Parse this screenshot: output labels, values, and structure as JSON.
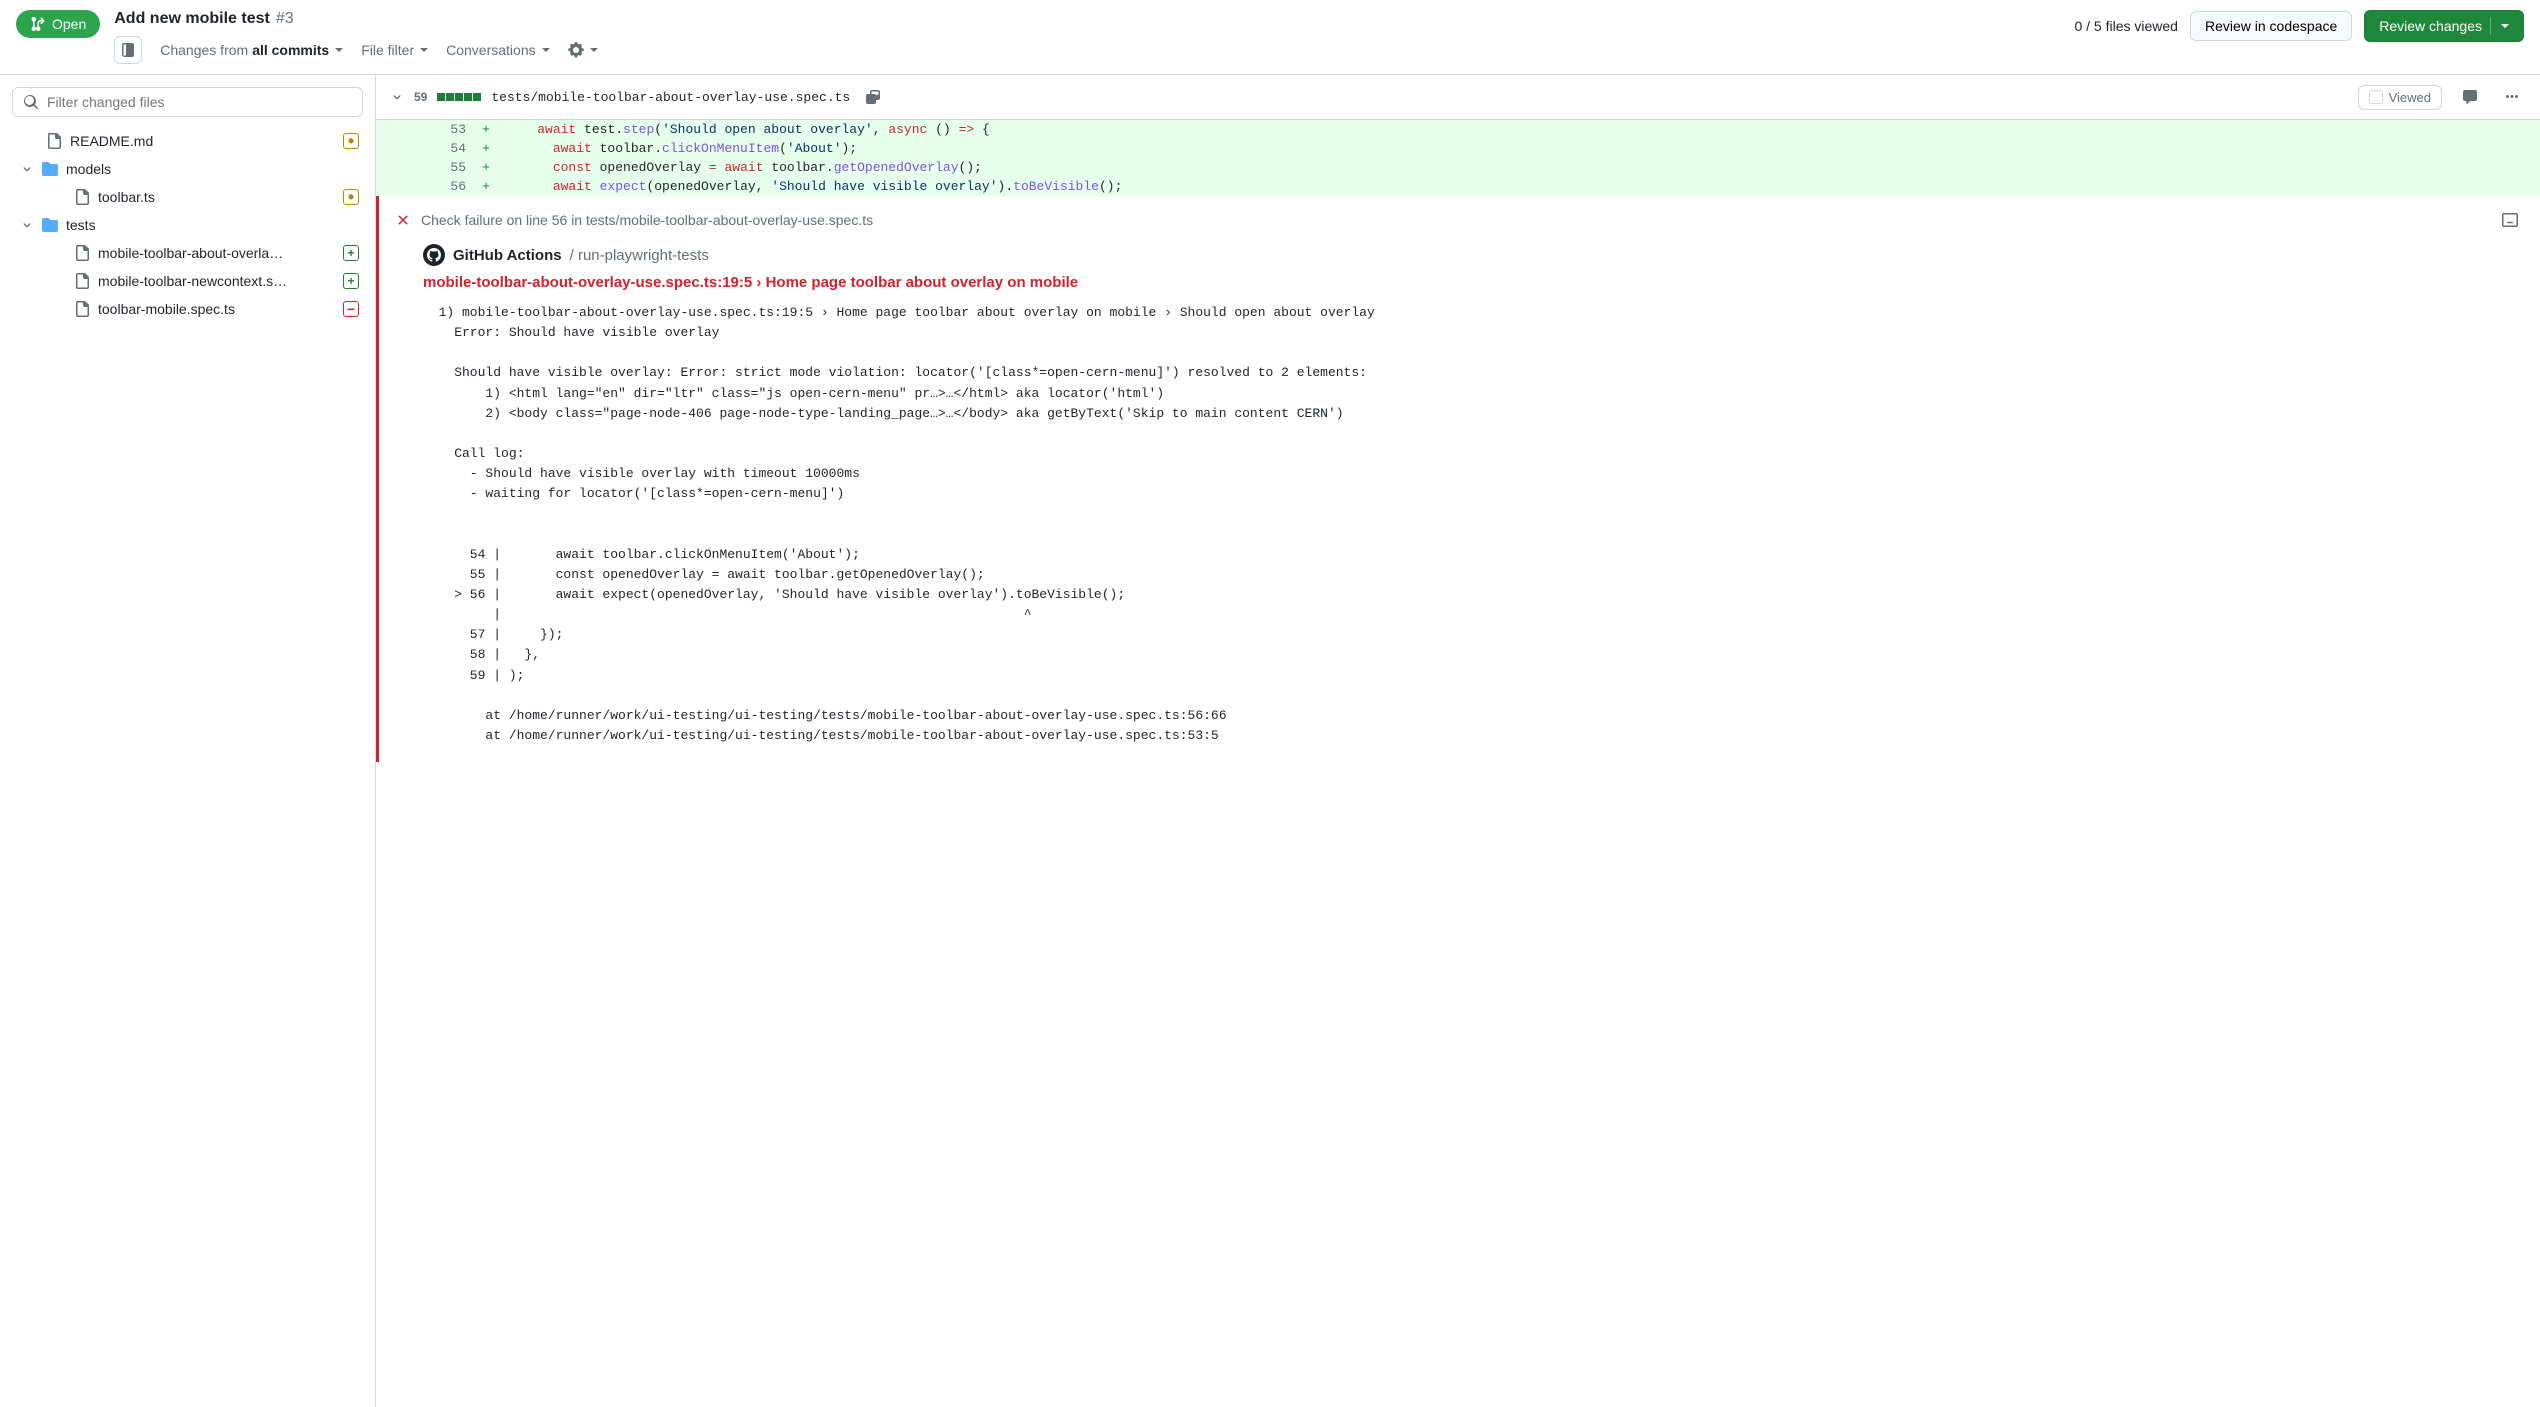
{
  "header": {
    "state": "Open",
    "title": "Add new mobile test",
    "pr_number": "#3",
    "changes_from_label": "Changes from",
    "changes_from_value": "all commits",
    "file_filter": "File filter",
    "conversations": "Conversations",
    "files_viewed": "0 / 5 files viewed",
    "review_codespace": "Review in codespace",
    "review_changes": "Review changes"
  },
  "sidebar": {
    "filter_placeholder": "Filter changed files",
    "items": [
      {
        "type": "file",
        "name": "README.md",
        "status": "modified",
        "indent": 0
      },
      {
        "type": "folder",
        "name": "models",
        "expanded": true,
        "indent": 0
      },
      {
        "type": "file",
        "name": "toolbar.ts",
        "status": "modified",
        "indent": 1
      },
      {
        "type": "folder",
        "name": "tests",
        "expanded": true,
        "indent": 0
      },
      {
        "type": "file",
        "name": "mobile-toolbar-about-overla…",
        "status": "added",
        "indent": 1
      },
      {
        "type": "file",
        "name": "mobile-toolbar-newcontext.s…",
        "status": "added",
        "indent": 1
      },
      {
        "type": "file",
        "name": "toolbar-mobile.spec.ts",
        "status": "removed",
        "indent": 1
      }
    ]
  },
  "file": {
    "additions": "59",
    "path": "tests/mobile-toolbar-about-overlay-use.spec.ts",
    "viewed_label": "Viewed",
    "lines": [
      {
        "num": "53",
        "marker": "+",
        "tokens": [
          [
            "",
            "    "
          ],
          [
            "kw",
            "await"
          ],
          [
            "",
            " test."
          ],
          [
            "fn",
            "step"
          ],
          [
            "",
            "("
          ],
          [
            "str",
            "'Should open about overlay'"
          ],
          [
            "",
            ", "
          ],
          [
            "kw",
            "async"
          ],
          [
            "",
            " () "
          ],
          [
            "op",
            "=>"
          ],
          [
            "",
            " {"
          ]
        ]
      },
      {
        "num": "54",
        "marker": "+",
        "tokens": [
          [
            "",
            "      "
          ],
          [
            "kw",
            "await"
          ],
          [
            "",
            " toolbar."
          ],
          [
            "fn",
            "clickOnMenuItem"
          ],
          [
            "",
            "("
          ],
          [
            "str",
            "'About'"
          ],
          [
            "",
            ");"
          ]
        ]
      },
      {
        "num": "55",
        "marker": "+",
        "tokens": [
          [
            "",
            "      "
          ],
          [
            "kw",
            "const"
          ],
          [
            "",
            " openedOverlay "
          ],
          [
            "op",
            "="
          ],
          [
            "",
            " "
          ],
          [
            "kw",
            "await"
          ],
          [
            "",
            " toolbar."
          ],
          [
            "fn",
            "getOpenedOverlay"
          ],
          [
            "",
            "();"
          ]
        ]
      },
      {
        "num": "56",
        "marker": "+",
        "tokens": [
          [
            "",
            "      "
          ],
          [
            "kw",
            "await"
          ],
          [
            "",
            " "
          ],
          [
            "fn",
            "expect"
          ],
          [
            "",
            "(openedOverlay, "
          ],
          [
            "str",
            "'Should have visible overlay'"
          ],
          [
            "",
            ")."
          ],
          [
            "fn",
            "toBeVisible"
          ],
          [
            "",
            "();"
          ]
        ]
      }
    ]
  },
  "annotation": {
    "check_line": "Check failure on line 56 in tests/mobile-toolbar-about-overlay-use.spec.ts",
    "app_name": "GitHub Actions",
    "app_context": "/ run-playwright-tests",
    "fail_title": "mobile-toolbar-about-overlay-use.spec.ts:19:5 › Home page toolbar about overlay on mobile",
    "log": "  1) mobile-toolbar-about-overlay-use.spec.ts:19:5 › Home page toolbar about overlay on mobile › Should open about overlay\n    Error: Should have visible overlay\n\n    Should have visible overlay: Error: strict mode violation: locator('[class*=open-cern-menu]') resolved to 2 elements:\n        1) <html lang=\"en\" dir=\"ltr\" class=\"js open-cern-menu\" pr…>…</html> aka locator('html')\n        2) <body class=\"page-node-406 page-node-type-landing_page…>…</body> aka getByText('Skip to main content CERN')\n\n    Call log:\n      - Should have visible overlay with timeout 10000ms\n      - waiting for locator('[class*=open-cern-menu]')\n\n\n      54 |       await toolbar.clickOnMenuItem('About');\n      55 |       const openedOverlay = await toolbar.getOpenedOverlay();\n    > 56 |       await expect(openedOverlay, 'Should have visible overlay').toBeVisible();\n         |                                                                   ^\n      57 |     });\n      58 |   },\n      59 | );\n\n        at /home/runner/work/ui-testing/ui-testing/tests/mobile-toolbar-about-overlay-use.spec.ts:56:66\n        at /home/runner/work/ui-testing/ui-testing/tests/mobile-toolbar-about-overlay-use.spec.ts:53:5"
  }
}
